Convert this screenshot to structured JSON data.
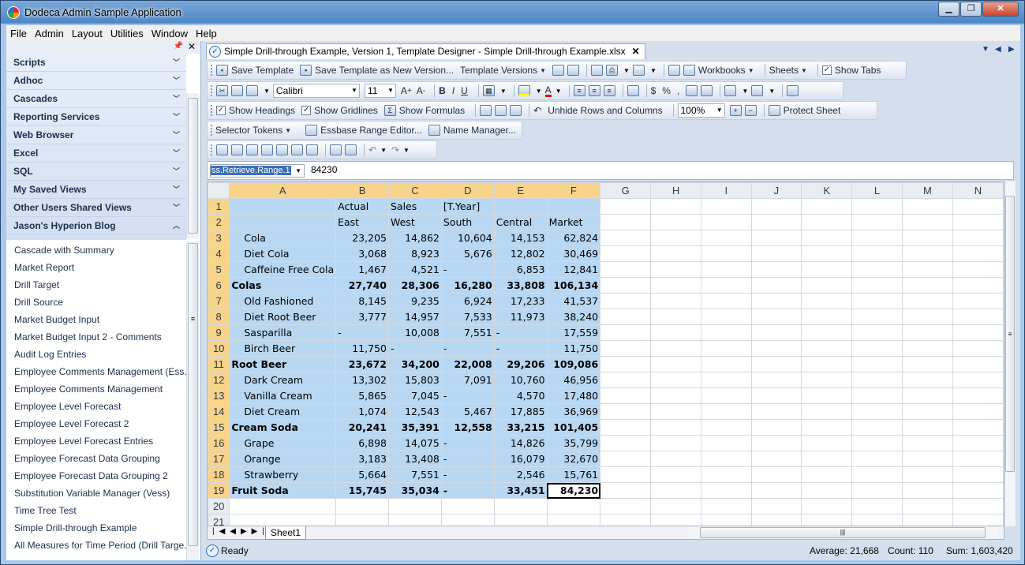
{
  "window": {
    "title": "Dodeca Admin Sample Application"
  },
  "menu": [
    "File",
    "Admin",
    "Layout",
    "Utilities",
    "Window",
    "Help"
  ],
  "sidebar": {
    "groups": [
      {
        "label": "Scripts",
        "state": "collapsed"
      },
      {
        "label": "Adhoc",
        "state": "collapsed"
      },
      {
        "label": "Cascades",
        "state": "collapsed"
      },
      {
        "label": "Reporting Services",
        "state": "collapsed"
      },
      {
        "label": "Web Browser",
        "state": "collapsed"
      },
      {
        "label": "Excel",
        "state": "collapsed"
      },
      {
        "label": "SQL",
        "state": "collapsed"
      },
      {
        "label": "My Saved Views",
        "state": "collapsed"
      },
      {
        "label": "Other Users Shared Views",
        "state": "collapsed"
      },
      {
        "label": "Jason's Hyperion Blog",
        "state": "expanded"
      }
    ],
    "items": [
      "Cascade with Summary",
      "Market Report",
      "Drill Target",
      "Drill Source",
      "Market Budget Input",
      "Market Budget Input 2 - Comments",
      "Audit Log Entries",
      "Employee Comments Management (Ess...",
      "Employee Comments Management",
      "Employee Level Forecast",
      "Employee Level Forecast 2",
      "Employee Level Forecast Entries",
      "Employee Forecast Data Grouping",
      "Employee Forecast Data Grouping 2",
      "Substitution Variable Manager (Vess)",
      "Time Tree Test",
      "Simple Drill-through Example",
      "All Measures for Time Period (Drill Targe..."
    ]
  },
  "doc_tab": {
    "title": "Simple Drill-through Example, Version 1, Template Designer - Simple Drill-through Example.xlsx"
  },
  "toolbar": {
    "save_template": "Save Template",
    "save_as_new": "Save Template as New Version...",
    "template_versions": "Template Versions",
    "workbooks": "Workbooks",
    "sheets": "Sheets",
    "show_tabs": "Show Tabs",
    "font": "Calibri",
    "font_size": "11",
    "show_headings": "Show Headings",
    "show_gridlines": "Show Gridlines",
    "show_formulas": "Show Formulas",
    "unhide": "Unhide Rows and Columns",
    "zoom": "100%",
    "protect": "Protect Sheet",
    "selector_tokens": "Selector Tokens",
    "essbase_range": "Essbase Range Editor...",
    "name_manager": "Name Manager..."
  },
  "formula": {
    "name_box": "ss.Retrieve.Range.1",
    "value": "84230"
  },
  "sheet": {
    "columns": [
      "A",
      "B",
      "C",
      "D",
      "E",
      "F",
      "G",
      "H",
      "I",
      "J",
      "K",
      "L",
      "M",
      "N"
    ],
    "rows": [
      {
        "n": "1",
        "cells": [
          "",
          "Actual",
          "Sales",
          "[T.Year]",
          "",
          ""
        ]
      },
      {
        "n": "2",
        "cells": [
          "",
          "East",
          "West",
          "South",
          "Central",
          "Market"
        ]
      },
      {
        "n": "3",
        "cells": [
          "Cola",
          "23,205",
          "14,862",
          "10,604",
          "14,153",
          "62,824"
        ]
      },
      {
        "n": "4",
        "cells": [
          "Diet Cola",
          "3,068",
          "8,923",
          "5,676",
          "12,802",
          "30,469"
        ]
      },
      {
        "n": "5",
        "cells": [
          "Caffeine Free Cola",
          "1,467",
          "4,521",
          "-",
          "6,853",
          "12,841"
        ]
      },
      {
        "n": "6",
        "cells": [
          "Colas",
          "27,740",
          "28,306",
          "16,280",
          "33,808",
          "106,134"
        ]
      },
      {
        "n": "7",
        "cells": [
          "Old Fashioned",
          "8,145",
          "9,235",
          "6,924",
          "17,233",
          "41,537"
        ]
      },
      {
        "n": "8",
        "cells": [
          "Diet Root Beer",
          "3,777",
          "14,957",
          "7,533",
          "11,973",
          "38,240"
        ]
      },
      {
        "n": "9",
        "cells": [
          "Sasparilla",
          "-",
          "10,008",
          "7,551",
          "-",
          "17,559"
        ]
      },
      {
        "n": "10",
        "cells": [
          "Birch Beer",
          "11,750",
          "-",
          "-",
          "-",
          "11,750"
        ]
      },
      {
        "n": "11",
        "cells": [
          "Root Beer",
          "23,672",
          "34,200",
          "22,008",
          "29,206",
          "109,086"
        ]
      },
      {
        "n": "12",
        "cells": [
          "Dark Cream",
          "13,302",
          "15,803",
          "7,091",
          "10,760",
          "46,956"
        ]
      },
      {
        "n": "13",
        "cells": [
          "Vanilla Cream",
          "5,865",
          "7,045",
          "-",
          "4,570",
          "17,480"
        ]
      },
      {
        "n": "14",
        "cells": [
          "Diet Cream",
          "1,074",
          "12,543",
          "5,467",
          "17,885",
          "36,969"
        ]
      },
      {
        "n": "15",
        "cells": [
          "Cream Soda",
          "20,241",
          "35,391",
          "12,558",
          "33,215",
          "101,405"
        ]
      },
      {
        "n": "16",
        "cells": [
          "Grape",
          "6,898",
          "14,075",
          "-",
          "14,826",
          "35,799"
        ]
      },
      {
        "n": "17",
        "cells": [
          "Orange",
          "3,183",
          "13,408",
          "-",
          "16,079",
          "32,670"
        ]
      },
      {
        "n": "18",
        "cells": [
          "Strawberry",
          "5,664",
          "7,551",
          "-",
          "2,546",
          "15,761"
        ]
      },
      {
        "n": "19",
        "cells": [
          "Fruit Soda",
          "15,745",
          "35,034",
          "-",
          "33,451",
          "84,230"
        ]
      },
      {
        "n": "20",
        "cells": [
          "",
          "",
          "",
          "",
          "",
          ""
        ]
      },
      {
        "n": "21",
        "cells": [
          "",
          "",
          "",
          "",
          "",
          ""
        ]
      }
    ],
    "tab": "Sheet1"
  },
  "status": {
    "ready": "Ready",
    "average": "Average: 21,668",
    "count": "Count: 110",
    "sum": "Sum: 1,603,420"
  }
}
